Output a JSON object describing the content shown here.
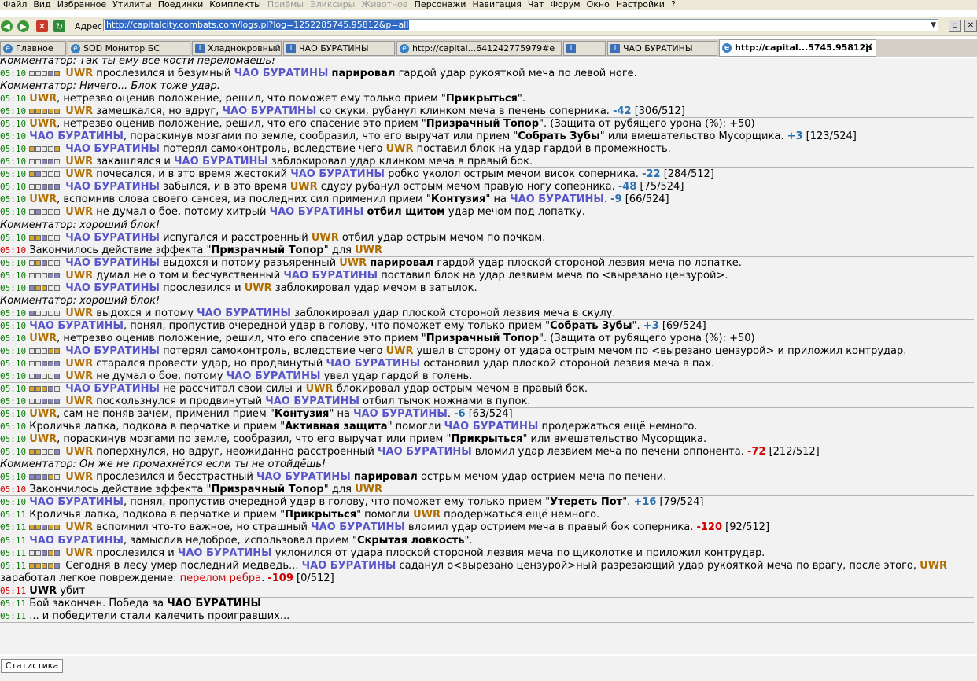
{
  "menu": [
    "Файл",
    "Вид",
    "Избранное",
    "Утилиты",
    "Поединки",
    "Комплекты",
    "Приёмы",
    "Эликсиры",
    "Животное",
    "Персонажи",
    "Навигация",
    "Чат",
    "Форум",
    "Окно",
    "Настройки",
    "?"
  ],
  "menu_disabled": [
    "Приёмы",
    "Эликсиры",
    "Животное"
  ],
  "address": {
    "label": "Адрес",
    "url": "http://capitalcity.combats.com/logs.pl?log=1252285745.95812&p=all"
  },
  "tabs": [
    {
      "label": "Главное"
    },
    {
      "label": "SOD Монитор БС"
    },
    {
      "label": "Хладнокровный"
    },
    {
      "label": "ЧАО БУРАТИНЫ"
    },
    {
      "label": "http://capital...641242775979#e"
    },
    {
      "label": ""
    },
    {
      "label": "ЧАО БУРАТИНЫ"
    },
    {
      "label": "http://capital...5745.95812p"
    }
  ],
  "players": {
    "p1": "ЧАО БУРАТИНЫ",
    "p2": "UWR"
  },
  "log": [
    {
      "type": "comment",
      "text": "Комментатор: Так ты ему все кости переломаешь!"
    },
    {
      "time": "05:10",
      "boxes": "eeebh",
      "parts": [
        [
          "n2",
          "UWR"
        ],
        [
          "t",
          " прослезился и безумный "
        ],
        [
          "n1",
          "ЧАО БУРАТИНЫ"
        ],
        [
          "t",
          " "
        ],
        [
          "k",
          "парировал"
        ],
        [
          "t",
          " гардой удар рукояткой меча по левой ноге."
        ]
      ]
    },
    {
      "type": "comment",
      "text": "Комментатор: Ничего... Блок тоже удар."
    },
    {
      "time": "05:10",
      "parts": [
        [
          "n2",
          "UWR"
        ],
        [
          "t",
          ", нетрезво оценив положение, решил, что поможет ему только прием \""
        ],
        [
          "k",
          "Прикрыться"
        ],
        [
          "t",
          "\"."
        ]
      ]
    },
    {
      "time": "05:10",
      "boxes": "hhhhh",
      "parts": [
        [
          "n2",
          "UWR"
        ],
        [
          "t",
          " замешкался, но вдруг, "
        ],
        [
          "n1",
          "ЧАО БУРАТИНЫ"
        ],
        [
          "t",
          " со скуки, рубанул клинком меча в печень соперника. "
        ],
        [
          "dm",
          "-42"
        ],
        [
          "t",
          " [306/512]"
        ]
      ]
    },
    {
      "sep": true
    },
    {
      "time": "05:10",
      "parts": [
        [
          "n2",
          "UWR"
        ],
        [
          "t",
          ", нетрезво оценив положение, решил, что его спасение это прием \""
        ],
        [
          "k",
          "Призрачный Топор"
        ],
        [
          "t",
          "\". (Защита от рубящего урона (%): +50)"
        ]
      ]
    },
    {
      "time": "05:10",
      "parts": [
        [
          "n1",
          "ЧАО БУРАТИНЫ"
        ],
        [
          "t",
          ", пораскинув мозгами по земле, сообразил, что его выручат или прием \""
        ],
        [
          "k",
          "Собрать Зубы"
        ],
        [
          "t",
          "\" или вмешательство Мусорщика. "
        ],
        [
          "dm",
          "+3"
        ],
        [
          "t",
          " [123/524]"
        ]
      ]
    },
    {
      "time": "05:10",
      "boxes": "heeeh",
      "parts": [
        [
          "n1",
          "ЧАО БУРАТИНЫ"
        ],
        [
          "t",
          " потерял самоконтроль, вследствие чего "
        ],
        [
          "n2",
          "UWR"
        ],
        [
          "t",
          " поставил блок на удар гардой в промежность."
        ]
      ]
    },
    {
      "time": "05:10",
      "boxes": "eebbe",
      "parts": [
        [
          "n2",
          "UWR"
        ],
        [
          "t",
          " закашлялся и "
        ],
        [
          "n1",
          "ЧАО БУРАТИНЫ"
        ],
        [
          "t",
          " заблокировал удар клинком меча в правый бок."
        ]
      ]
    },
    {
      "sep": true
    },
    {
      "time": "05:10",
      "boxes": "hbeee",
      "parts": [
        [
          "n2",
          "UWR"
        ],
        [
          "t",
          " почесался, и в это время жестокий "
        ],
        [
          "n1",
          "ЧАО БУРАТИНЫ"
        ],
        [
          "t",
          " робко уколол острым мечом висок соперника. "
        ],
        [
          "dm",
          "-22"
        ],
        [
          "t",
          " [284/512]"
        ]
      ]
    },
    {
      "time": "05:10",
      "boxes": "eebbb",
      "parts": [
        [
          "n1",
          "ЧАО БУРАТИНЫ"
        ],
        [
          "t",
          " забылся, и в это время "
        ],
        [
          "n2",
          "UWR"
        ],
        [
          "t",
          " сдуру рубанул острым мечом правую ногу соперника. "
        ],
        [
          "dm",
          "-48"
        ],
        [
          "t",
          " [75/524]"
        ]
      ]
    },
    {
      "sep": true
    },
    {
      "time": "05:10",
      "parts": [
        [
          "n2",
          "UWR"
        ],
        [
          "t",
          ", вспомнив слова своего сэнсея, из последних сил применил прием \""
        ],
        [
          "k",
          "Контузия"
        ],
        [
          "t",
          "\" на "
        ],
        [
          "n1",
          "ЧАО БУРАТИНЫ"
        ],
        [
          "t",
          ". "
        ],
        [
          "dm",
          "-9"
        ],
        [
          "t",
          " [66/524]"
        ]
      ]
    },
    {
      "time": "05:10",
      "boxes": "ebeee",
      "parts": [
        [
          "n2",
          "UWR"
        ],
        [
          "t",
          " не думал о бое, потому хитрый "
        ],
        [
          "n1",
          "ЧАО БУРАТИНЫ"
        ],
        [
          "t",
          " "
        ],
        [
          "k",
          "отбил щитом"
        ],
        [
          "t",
          " удар мечом под лопатку."
        ]
      ]
    },
    {
      "type": "comment",
      "text": "Комментатор: хороший блок!"
    },
    {
      "time": "05:10",
      "boxes": "hhbee",
      "parts": [
        [
          "n1",
          "ЧАО БУРАТИНЫ"
        ],
        [
          "t",
          " испугался и расстроенный "
        ],
        [
          "n2",
          "UWR"
        ],
        [
          "t",
          " отбил удар острым мечом по почкам."
        ]
      ]
    },
    {
      "time": "05:10",
      "timeRed": true,
      "parts": [
        [
          "t",
          "Закончилось действие эффекта \""
        ],
        [
          "k",
          "Призрачный Топор"
        ],
        [
          "t",
          "\" для "
        ],
        [
          "n2",
          "UWR"
        ]
      ]
    },
    {
      "sep": true
    },
    {
      "time": "05:10",
      "boxes": "ehbee",
      "parts": [
        [
          "n1",
          "ЧАО БУРАТИНЫ"
        ],
        [
          "t",
          " выдохся и потому разъяренный "
        ],
        [
          "n2",
          "UWR"
        ],
        [
          "t",
          " "
        ],
        [
          "k",
          "парировал"
        ],
        [
          "t",
          " гардой удар плоской стороной лезвия меча по лопатке."
        ]
      ]
    },
    {
      "time": "05:10",
      "boxes": "eeebb",
      "parts": [
        [
          "n2",
          "UWR"
        ],
        [
          "t",
          " думал не о том и бесчувственный "
        ],
        [
          "n1",
          "ЧАО БУРАТИНЫ"
        ],
        [
          "t",
          " поставил блок на удар лезвием меча по <вырезано цензурой>."
        ]
      ]
    },
    {
      "sep": true
    },
    {
      "time": "05:10",
      "boxes": "bhhee",
      "parts": [
        [
          "n1",
          "ЧАО БУРАТИНЫ"
        ],
        [
          "t",
          " прослезился и "
        ],
        [
          "n2",
          "UWR"
        ],
        [
          "t",
          " заблокировал удар мечом в затылок."
        ]
      ]
    },
    {
      "type": "comment",
      "text": "Комментатор: хороший блок!"
    },
    {
      "time": "05:10",
      "boxes": "beeee",
      "parts": [
        [
          "n2",
          "UWR"
        ],
        [
          "t",
          " выдохся и потому "
        ],
        [
          "n1",
          "ЧАО БУРАТИНЫ"
        ],
        [
          "t",
          " заблокировал удар плоской стороной лезвия меча в скулу."
        ]
      ]
    },
    {
      "sep": true
    },
    {
      "time": "05:10",
      "parts": [
        [
          "n1",
          "ЧАО БУРАТИНЫ"
        ],
        [
          "t",
          ", понял, пропустив очередной удар в голову, что поможет ему только прием \""
        ],
        [
          "k",
          "Собрать Зубы"
        ],
        [
          "t",
          "\". "
        ],
        [
          "dm",
          "+3"
        ],
        [
          "t",
          " [69/524]"
        ]
      ]
    },
    {
      "time": "05:10",
      "parts": [
        [
          "n2",
          "UWR"
        ],
        [
          "t",
          ", нетрезво оценив положение, решил, что его спасение это прием \""
        ],
        [
          "k",
          "Призрачный Топор"
        ],
        [
          "t",
          "\". (Защита от рубящего урона (%): +50)"
        ]
      ]
    },
    {
      "time": "05:10",
      "boxes": "eeehh",
      "parts": [
        [
          "n1",
          "ЧАО БУРАТИНЫ"
        ],
        [
          "t",
          " потерял самоконтроль, вследствие чего "
        ],
        [
          "n2",
          "UWR"
        ],
        [
          "t",
          " ушел в сторону от удара острым мечом по <вырезано цензурой> и приложил контрудар."
        ]
      ]
    },
    {
      "time": "05:10",
      "boxes": "eebbb",
      "parts": [
        [
          "n2",
          "UWR"
        ],
        [
          "t",
          " старался провести удар, но продвинутый "
        ],
        [
          "n1",
          "ЧАО БУРАТИНЫ"
        ],
        [
          "t",
          " остановил удар плоской стороной лезвия меча в пах."
        ]
      ]
    },
    {
      "time": "05:10",
      "boxes": "ebeeb",
      "parts": [
        [
          "n2",
          "UWR"
        ],
        [
          "t",
          " не думал о бое, потому "
        ],
        [
          "n1",
          "ЧАО БУРАТИНЫ"
        ],
        [
          "t",
          " увел удар гардой в голень."
        ]
      ]
    },
    {
      "sep": true
    },
    {
      "time": "05:10",
      "boxes": "hhhbe",
      "parts": [
        [
          "n1",
          "ЧАО БУРАТИНЫ"
        ],
        [
          "t",
          " не рассчитал свои силы и "
        ],
        [
          "n2",
          "UWR"
        ],
        [
          "t",
          " блокировал удар острым мечом в правый бок."
        ]
      ]
    },
    {
      "time": "05:10",
      "boxes": "eebbb",
      "parts": [
        [
          "n2",
          "UWR"
        ],
        [
          "t",
          " поскользнулся и продвинутый "
        ],
        [
          "n1",
          "ЧАО БУРАТИНЫ"
        ],
        [
          "t",
          " отбил тычок ножнами в пупок."
        ]
      ]
    },
    {
      "sep": true
    },
    {
      "time": "05:10",
      "parts": [
        [
          "n2",
          "UWR"
        ],
        [
          "t",
          ", сам не поняв зачем, применил прием \""
        ],
        [
          "k",
          "Контузия"
        ],
        [
          "t",
          "\" на "
        ],
        [
          "n1",
          "ЧАО БУРАТИНЫ"
        ],
        [
          "t",
          ". "
        ],
        [
          "dm",
          "-6"
        ],
        [
          "t",
          " [63/524]"
        ]
      ]
    },
    {
      "time": "05:10",
      "parts": [
        [
          "t",
          "Кроличья лапка, подкова в перчатке и прием \""
        ],
        [
          "k",
          "Активная защита"
        ],
        [
          "t",
          "\" помогли "
        ],
        [
          "n1",
          "ЧАО БУРАТИНЫ"
        ],
        [
          "t",
          " продержаться ещё немного."
        ]
      ]
    },
    {
      "time": "05:10",
      "parts": [
        [
          "n2",
          "UWR"
        ],
        [
          "t",
          ", пораскинув мозгами по земле, сообразил, что его выручат или прием \""
        ],
        [
          "k",
          "Прикрыться"
        ],
        [
          "t",
          "\" или вмешательство Мусорщика."
        ]
      ]
    },
    {
      "time": "05:10",
      "boxes": "hheeb",
      "parts": [
        [
          "n2",
          "UWR"
        ],
        [
          "t",
          " поперхнулся, но вдруг, неожиданно расстроенный "
        ],
        [
          "n1",
          "ЧАО БУРАТИНЫ"
        ],
        [
          "t",
          " вломил удар лезвием меча по печени оппонента. "
        ],
        [
          "dmr",
          "-72"
        ],
        [
          "t",
          " [212/512]"
        ]
      ]
    },
    {
      "type": "comment",
      "text": "Комментатор: Он же не промахнётся если ты не отойдёшь!"
    },
    {
      "time": "05:10",
      "boxes": "bbbhe",
      "parts": [
        [
          "n2",
          "UWR"
        ],
        [
          "t",
          " прослезился и бесстрастный "
        ],
        [
          "n1",
          "ЧАО БУРАТИНЫ"
        ],
        [
          "t",
          " "
        ],
        [
          "k",
          "парировал"
        ],
        [
          "t",
          " острым мечом удар острием меча по печени."
        ]
      ]
    },
    {
      "time": "05:10",
      "timeRed": true,
      "parts": [
        [
          "t",
          "Закончилось действие эффекта \""
        ],
        [
          "k",
          "Призрачный Топор"
        ],
        [
          "t",
          "\" для "
        ],
        [
          "n2",
          "UWR"
        ]
      ]
    },
    {
      "sep": true
    },
    {
      "time": "05:10",
      "parts": [
        [
          "n1",
          "ЧАО БУРАТИНЫ"
        ],
        [
          "t",
          ", понял, пропустив очередной удар в голову, что поможет ему только прием \""
        ],
        [
          "k",
          "Утереть Пот"
        ],
        [
          "t",
          "\". "
        ],
        [
          "dm",
          "+16"
        ],
        [
          "t",
          " [79/524]"
        ]
      ]
    },
    {
      "time": "05:11",
      "parts": [
        [
          "t",
          "Кроличья лапка, подкова в перчатке и прием \""
        ],
        [
          "k",
          "Прикрыться"
        ],
        [
          "t",
          "\" помогли "
        ],
        [
          "n2",
          "UWR"
        ],
        [
          "t",
          " продержаться ещё немного."
        ]
      ]
    },
    {
      "time": "05:11",
      "boxes": "hhbhh",
      "parts": [
        [
          "n2",
          "UWR"
        ],
        [
          "t",
          " вспомнил что-то важное, но страшный "
        ],
        [
          "n1",
          "ЧАО БУРАТИНЫ"
        ],
        [
          "t",
          " вломил удар острием меча в правый бок соперника. "
        ],
        [
          "dmr",
          "-120"
        ],
        [
          "t",
          " [92/512]"
        ]
      ]
    },
    {
      "time": "05:11",
      "parts": [
        [
          "n1",
          "ЧАО БУРАТИНЫ"
        ],
        [
          "t",
          ", замыслив недоброе, использовал прием \""
        ],
        [
          "k",
          "Скрытая ловкость"
        ],
        [
          "t",
          "\"."
        ]
      ]
    },
    {
      "time": "05:11",
      "boxes": "eebhb",
      "parts": [
        [
          "n2",
          "UWR"
        ],
        [
          "t",
          " прослезился и "
        ],
        [
          "n1",
          "ЧАО БУРАТИНЫ"
        ],
        [
          "t",
          " уклонился от удара плоской стороной лезвия меча по щиколотке и приложил контрудар."
        ]
      ]
    },
    {
      "time": "05:11",
      "boxes": "hhhhb",
      "parts": [
        [
          "t",
          "Сегодня в лесу умер последний медведь... "
        ],
        [
          "n1",
          "ЧАО БУРАТИНЫ"
        ],
        [
          "t",
          " саданул о<вырезано цензурой>ный разрезающий удар рукояткой меча по врагу, после этого, "
        ],
        [
          "n2",
          "UWR"
        ]
      ]
    },
    {
      "type": "wrap",
      "parts": [
        [
          "t",
          "заработал легкое повреждение: "
        ],
        [
          "r",
          "перелом ребра"
        ],
        [
          "t",
          ". "
        ],
        [
          "dmr",
          "-109"
        ],
        [
          "t",
          " [0/512]"
        ]
      ]
    },
    {
      "time": "05:11",
      "timeRed": true,
      "parts": [
        [
          "k",
          "UWR"
        ],
        [
          "t",
          " убит"
        ]
      ]
    },
    {
      "sep": true
    },
    {
      "time": "05:11",
      "parts": [
        [
          "t",
          "Бой закончен. Победа за "
        ],
        [
          "k",
          "ЧАО БУРАТИНЫ"
        ]
      ]
    },
    {
      "time": "05:11",
      "parts": [
        [
          "t",
          "... и победители стали калечить проигравших..."
        ]
      ]
    },
    {
      "sep": true
    }
  ],
  "status": {
    "stats_button": "Статистика"
  },
  "colors": {
    "p1": "#5856c9",
    "p2": "#b06e00",
    "time": "#0a7a0a",
    "damage": "#2a6fb0",
    "crit": "#d00000"
  }
}
